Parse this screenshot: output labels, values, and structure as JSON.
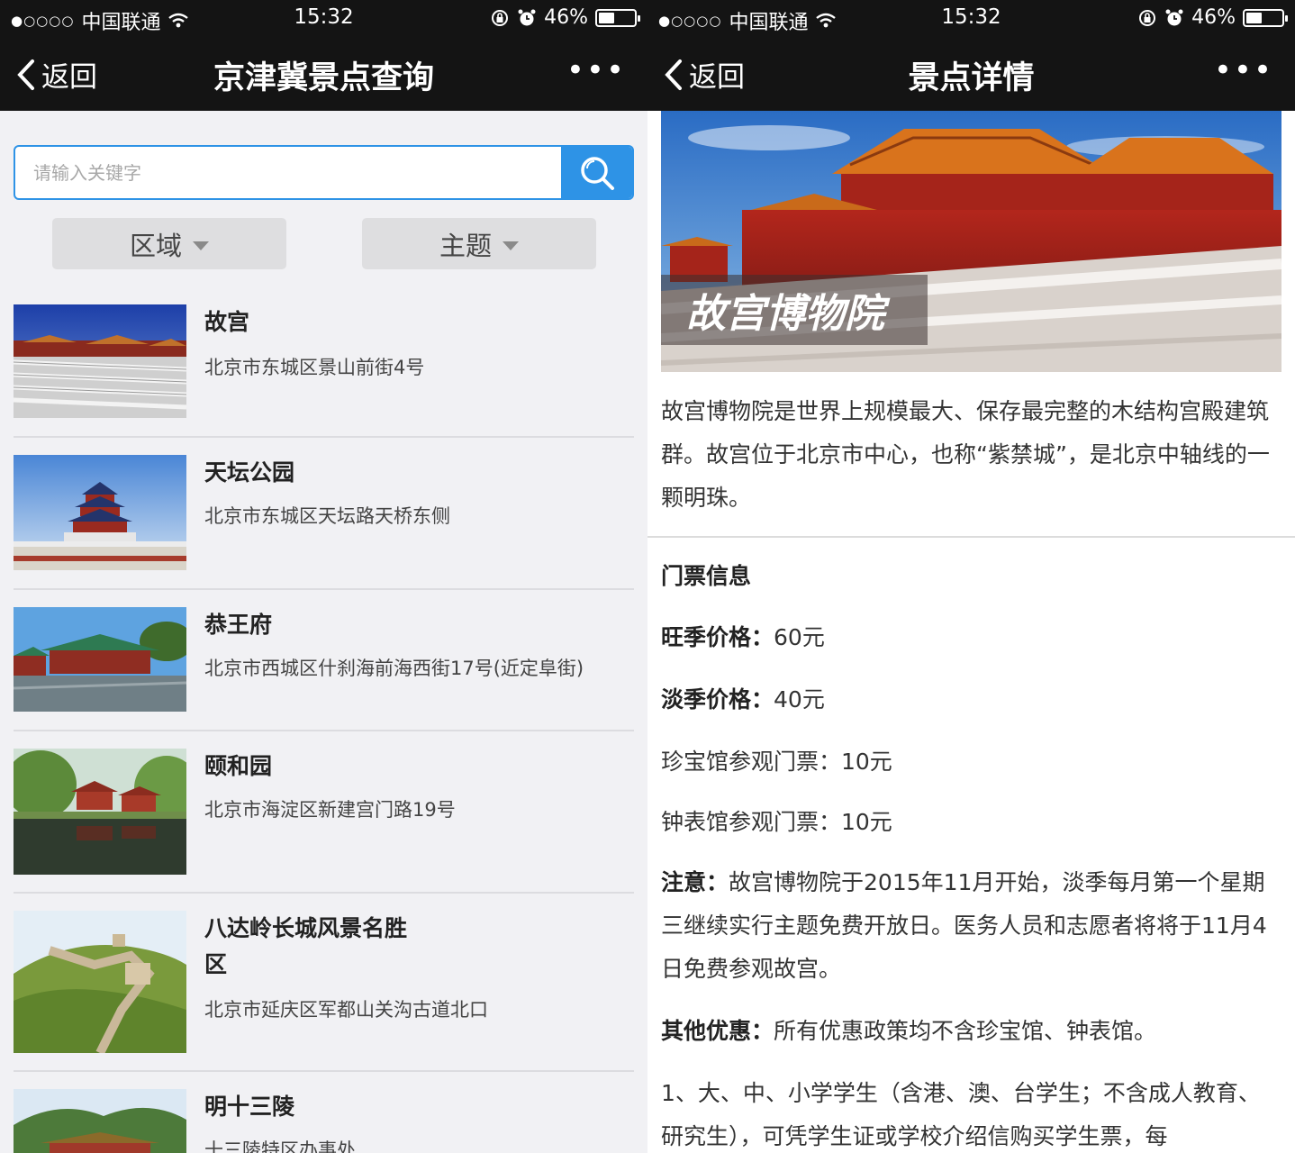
{
  "status_bar": {
    "signal": "●○○○○",
    "carrier": "中国联通",
    "time": "15:32",
    "battery": "46%",
    "battery_level": 0.46
  },
  "list_screen": {
    "nav": {
      "back": "返回",
      "title": "京津冀景点查询"
    },
    "search": {
      "placeholder": "请输入关键字"
    },
    "filters": {
      "region": "区域",
      "theme": "主题"
    },
    "items": [
      {
        "name": "故宫",
        "address": "北京市东城区景山前街4号"
      },
      {
        "name": "天坛公园",
        "address": "北京市东城区天坛路天桥东侧"
      },
      {
        "name": "恭王府",
        "address": "北京市西城区什刹海前海西街17号(近定阜街)"
      },
      {
        "name": "颐和园",
        "address": "北京市海淀区新建宫门路19号"
      },
      {
        "name": "八达岭长城风景名胜区",
        "address": "北京市延庆区军都山关沟古道北口"
      },
      {
        "name": "明十三陵",
        "address": "十三陵特区办事处"
      }
    ]
  },
  "detail_screen": {
    "nav": {
      "back": "返回",
      "title": "景点详情"
    },
    "hero_caption": "故宫博物院",
    "intro": "故宫博物院是世界上规模最大、保存最完整的木结构宫殿建筑群。故宫位于北京市中心，也称“紫禁城”，是北京中轴线的一颗明珠。",
    "ticket_title": "门票信息",
    "peak_label": "旺季价格：",
    "peak_value": "60元",
    "off_label": "淡季价格：",
    "off_value": "40元",
    "treasure": "珍宝馆参观门票：10元",
    "clock": "钟表馆参观门票：10元",
    "notice_label": "注意：",
    "notice_text": "故宫博物院于2015年11月开始，淡季每月第一个星期三继续实行主题免费开放日。医务人员和志愿者将将于11月4日免费参观故宫。",
    "other_label": "其他优惠：",
    "other_text": "所有优惠政策均不含珍宝馆、钟表馆。",
    "rule1": "1、大、中、小学学生（含港、澳、台学生；不含成人教育、研究生），可凭学生证或学校介绍信购买学生票，每"
  }
}
